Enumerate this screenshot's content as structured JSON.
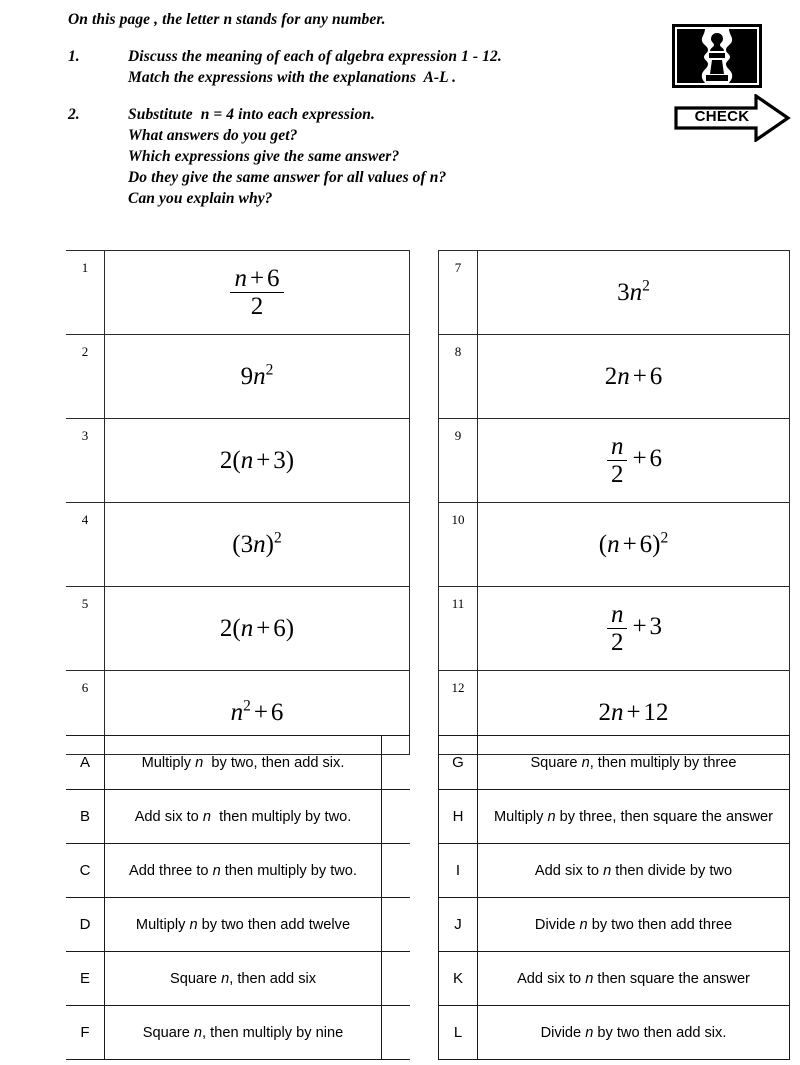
{
  "header": {
    "intro": "On this page , the letter n stands for any number.",
    "tasks": [
      {
        "number": "1.",
        "lines": [
          "Discuss the meaning of each of algebra expression 1 - 12.",
          "Match the expressions with the explanations  A-L ."
        ]
      },
      {
        "number": "2.",
        "lines": [
          "Substitute  n = 4 into each expression.",
          "What answers do you get?",
          "Which expressions give the same answer?",
          "Do they give the same answer for all values of n?",
          "Can you explain why?"
        ]
      }
    ]
  },
  "badge": {
    "logo_icon": "two-faces-profile-illusion-icon",
    "check_label": "CHECK",
    "arrow_icon": "right-arrow-icon"
  },
  "expressions": {
    "left": [
      {
        "number": "1",
        "expression": "(n + 6) / 2"
      },
      {
        "number": "2",
        "expression": "9n^2"
      },
      {
        "number": "3",
        "expression": "2(n + 3)"
      },
      {
        "number": "4",
        "expression": "(3n)^2"
      },
      {
        "number": "5",
        "expression": "2(n + 6)"
      },
      {
        "number": "6",
        "expression": "n^2 + 6"
      }
    ],
    "right": [
      {
        "number": "7",
        "expression": "3n^2"
      },
      {
        "number": "8",
        "expression": "2n + 6"
      },
      {
        "number": "9",
        "expression": "n/2 + 6"
      },
      {
        "number": "10",
        "expression": "(n + 6)^2"
      },
      {
        "number": "11",
        "expression": "n/2 + 3"
      },
      {
        "number": "12",
        "expression": "2n + 12"
      }
    ]
  },
  "explanations": {
    "left": [
      {
        "letter": "A",
        "text": "Multiply n  by two, then add six."
      },
      {
        "letter": "B",
        "text": "Add six to n  then multiply by two."
      },
      {
        "letter": "C",
        "text": "Add three to n then multiply by two."
      },
      {
        "letter": "D",
        "text": "Multiply n by two then add twelve"
      },
      {
        "letter": "E",
        "text": "Square n, then add six"
      },
      {
        "letter": "F",
        "text": "Square n, then multiply by nine"
      }
    ],
    "right": [
      {
        "letter": "G",
        "text": "Square n, then multiply by three"
      },
      {
        "letter": "H",
        "text": "Multiply n by three, then square the answer"
      },
      {
        "letter": "I",
        "text": "Add six to n then divide by two"
      },
      {
        "letter": "J",
        "text": "Divide n by two then add three"
      },
      {
        "letter": "K",
        "text": "Add six to n then square the answer"
      },
      {
        "letter": "L",
        "text": "Divide n by two then add six."
      }
    ]
  },
  "colors": {
    "ink": "#000000",
    "rule": "#2a2a2a",
    "page": "#ffffff"
  }
}
